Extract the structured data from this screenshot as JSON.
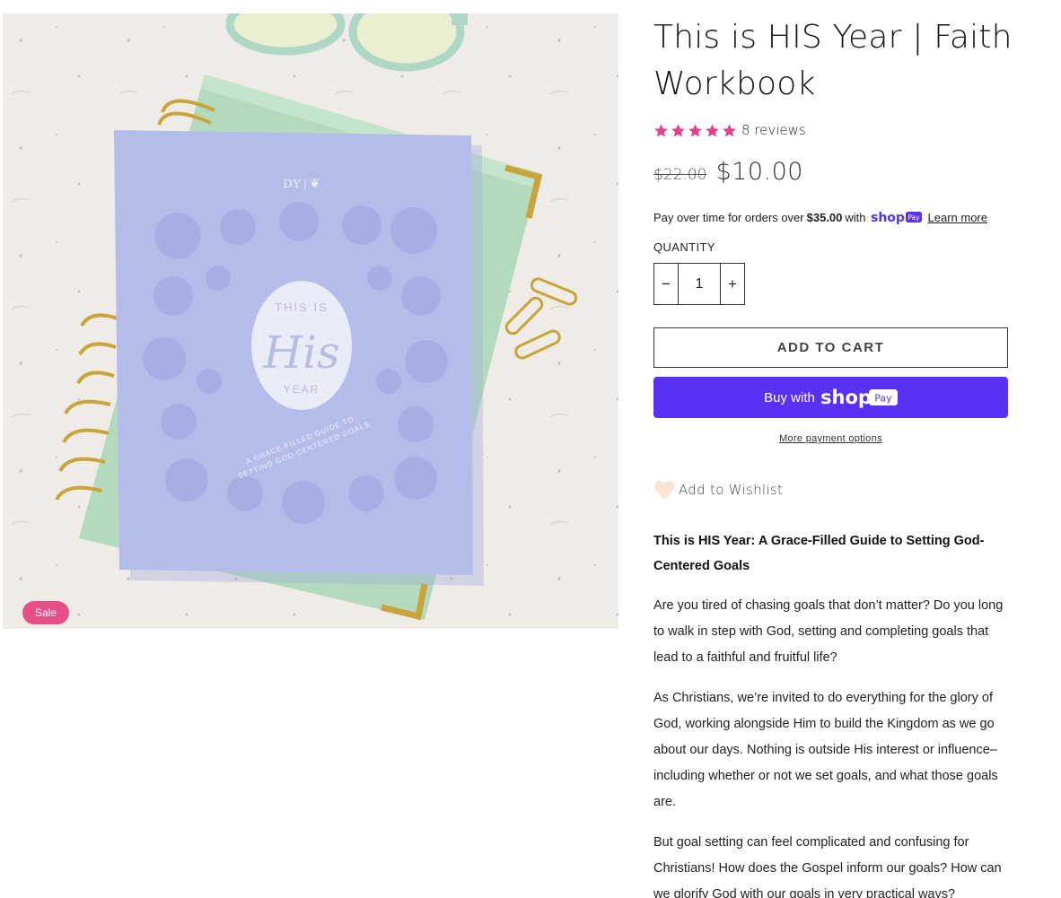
{
  "product": {
    "title": "This is HIS Year | Faith Workbook",
    "rating_stars": 5,
    "reviews_label": "8 reviews",
    "price_compare": "$22.00",
    "price_sale": "$10.00",
    "sale_badge": "Sale"
  },
  "cover": {
    "small_top": "THIS IS",
    "script_word": "His",
    "small_bottom": "YEAR",
    "subtitle_line1": "A GRACE-FILLED GUIDE TO",
    "subtitle_line2": "SETTING GOD-CENTERED GOALS",
    "brand_mark": "DY | ❦"
  },
  "installments": {
    "prefix": "Pay over time for orders over",
    "amount": "$35.00",
    "suffix": "with",
    "learn_more": "Learn more"
  },
  "quantity": {
    "label": "QUANTITY",
    "value": "1",
    "minus": "−",
    "plus": "+"
  },
  "buttons": {
    "add_to_cart": "ADD TO CART",
    "buy_with": "Buy with",
    "more_payment": "More payment options"
  },
  "wishlist": {
    "label": "Add to Wishlist"
  },
  "description": {
    "heading": "This is HIS Year: A Grace-Filled Guide to Setting God-Centered Goals",
    "paragraphs": [
      "Are you tired of chasing goals that don’t matter? Do you long to walk in step with God, setting and completing goals that lead to a faithful and fruitful life?",
      "As Christians, we’re invited to do everything for the glory of God, working alongside Him to build the Kingdom as we go about our days. Nothing is outside His interest or influence–including whether or not we set goals, and what those goals are.",
      "But goal setting can feel complicated and confusing for Christians! How does the Gospel inform our goals? How can we glorify God with our goals in very practical ways?"
    ]
  },
  "colors": {
    "star": "#e5408a",
    "sale_badge": "#e54f86",
    "shop_pay": "#5a31f4",
    "cover_lavender": "#b4bdea",
    "notebook_green": "#b6dbc0",
    "gold": "#c9a43a"
  },
  "icons": {
    "star": "star-icon",
    "heart": "heart-icon",
    "minus": "minus-icon",
    "plus": "plus-icon",
    "shop_pay": "shop-pay-logo"
  }
}
